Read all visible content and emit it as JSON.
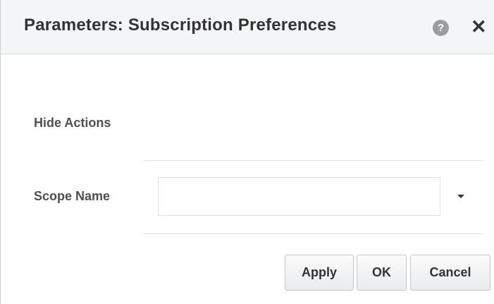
{
  "dialog": {
    "title": "Parameters: Subscription Preferences",
    "help_icon": "help-icon",
    "help_glyph": "?",
    "close_icon": "close-icon",
    "close_glyph": "✕"
  },
  "form": {
    "hide_actions_label": "Hide Actions",
    "scope_name_label": "Scope Name",
    "scope_name_value": "",
    "scope_name_dropdown_icon": "chevron-down-icon"
  },
  "buttons": {
    "apply": "Apply",
    "ok": "OK",
    "cancel": "Cancel"
  },
  "colors": {
    "title_bar": "#f4f5f6",
    "text": "#333333",
    "help_icon_bg": "#9a9ea3"
  }
}
